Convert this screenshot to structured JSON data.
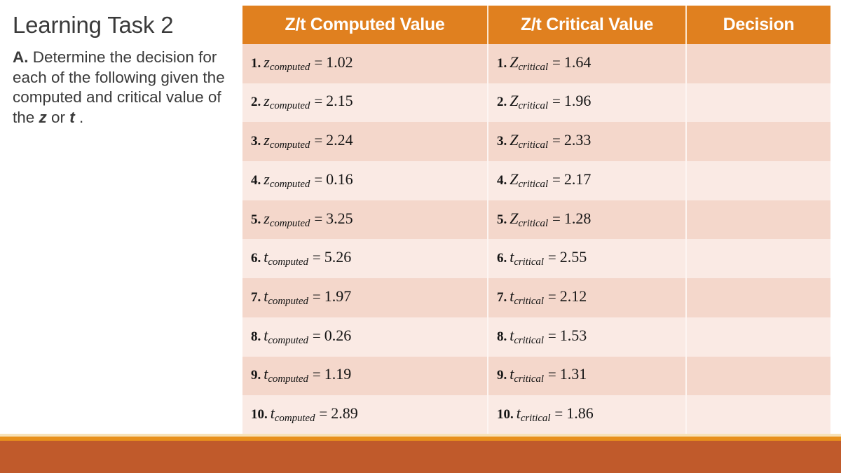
{
  "slide": {
    "title": "Learning Task 2",
    "instruction_prefix": "A.",
    "instruction_text": " Determine the decision for each of the following given the computed and critical value of the ",
    "instruction_sym1": "z",
    "instruction_mid": " or ",
    "instruction_sym2": "t",
    "instruction_suffix": " ."
  },
  "colors": {
    "header_orange": "#E0801F",
    "row_dark": "#F4D7CB",
    "row_light": "#FAEAE4",
    "bottom_bar_rust": "#C05A2B",
    "bottom_bar_orange": "#E8901C",
    "bottom_bar_cream": "#F7E2B8",
    "text_gray": "#3A3A3A"
  },
  "table": {
    "headers": [
      "Z/t Computed Value",
      "Z/t Critical Value",
      "Decision"
    ],
    "rows": [
      {
        "index": "1.",
        "computed": {
          "var": "z",
          "sub": "computed",
          "eq": "=",
          "value": "1.02"
        },
        "critical": {
          "var": "Z",
          "sub": "critical",
          "eq": "=",
          "value": "1.64"
        },
        "decision": ""
      },
      {
        "index": "2.",
        "computed": {
          "var": "z",
          "sub": "computed",
          "eq": "=",
          "value": "2.15"
        },
        "critical": {
          "var": "Z",
          "sub": "critical",
          "eq": "=",
          "value": "1.96"
        },
        "decision": ""
      },
      {
        "index": "3.",
        "computed": {
          "var": "z",
          "sub": "computed",
          "eq": "=",
          "value": "2.24"
        },
        "critical": {
          "var": "Z",
          "sub": "critical",
          "eq": "=",
          "value": "2.33"
        },
        "decision": ""
      },
      {
        "index": "4.",
        "computed": {
          "var": "z",
          "sub": "computed",
          "eq": "=",
          "value": "0.16"
        },
        "critical": {
          "var": "Z",
          "sub": "critical",
          "eq": "=",
          "value": "2.17"
        },
        "decision": ""
      },
      {
        "index": "5.",
        "computed": {
          "var": "z",
          "sub": "computed",
          "eq": "=",
          "value": "3.25"
        },
        "critical": {
          "var": "Z",
          "sub": "critical",
          "eq": "=",
          "value": "1.28"
        },
        "decision": ""
      },
      {
        "index": "6.",
        "computed": {
          "var": "t",
          "sub": "computed",
          "eq": "=",
          "value": "5.26"
        },
        "critical": {
          "var": "t",
          "sub": "critical",
          "eq": "=",
          "value": "2.55"
        },
        "decision": ""
      },
      {
        "index": "7.",
        "computed": {
          "var": "t",
          "sub": "computed",
          "eq": "=",
          "value": "1.97"
        },
        "critical": {
          "var": "t",
          "sub": "critical",
          "eq": "=",
          "value": "2.12"
        },
        "decision": ""
      },
      {
        "index": "8.",
        "computed": {
          "var": "t",
          "sub": "computed",
          "eq": "=",
          "value": "0.26"
        },
        "critical": {
          "var": "t",
          "sub": "critical",
          "eq": "=",
          "value": "1.53"
        },
        "decision": ""
      },
      {
        "index": "9.",
        "computed": {
          "var": "t",
          "sub": "computed",
          "eq": "=",
          "value": "1.19"
        },
        "critical": {
          "var": "t",
          "sub": "critical",
          "eq": "=",
          "value": "1.31"
        },
        "decision": ""
      },
      {
        "index": "10.",
        "computed": {
          "var": "t",
          "sub": "computed",
          "eq": "=",
          "value": "2.89"
        },
        "critical": {
          "var": "t",
          "sub": "critical",
          "eq": "=",
          "value": "1.86"
        },
        "decision": ""
      }
    ]
  }
}
